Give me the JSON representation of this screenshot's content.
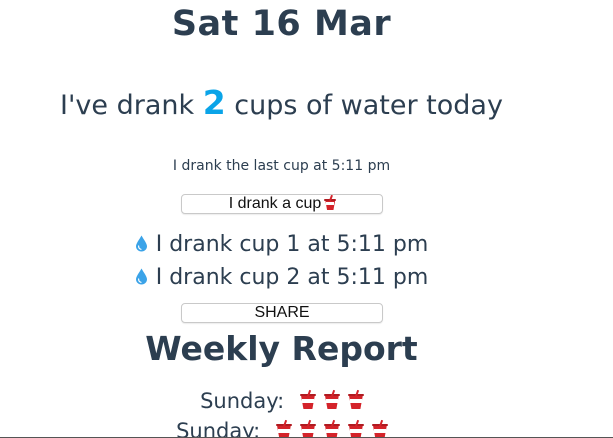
{
  "header": {
    "date": "Sat 16 Mar"
  },
  "summary": {
    "prefix": "I've drank",
    "count": "2",
    "suffix": "cups of water today",
    "last_cup": "I drank the last cup at 5:11 pm"
  },
  "buttons": {
    "drink_label": "I drank a cup",
    "drink_icon": "tropical-drink-cup-icon",
    "share_label": "SHARE"
  },
  "log": [
    {
      "icon": "droplet-icon",
      "text": "I drank cup 1 at 5:11 pm"
    },
    {
      "icon": "droplet-icon",
      "text": "I drank cup 2 at 5:11 pm"
    }
  ],
  "report": {
    "title": "Weekly Report",
    "days": [
      {
        "label": "Sunday:",
        "cups": 3
      },
      {
        "label": "Sunday:",
        "cups": 5
      }
    ]
  },
  "colors": {
    "text": "#2c3e50",
    "accent": "#0aa4e8",
    "cup": "#d4232a"
  }
}
